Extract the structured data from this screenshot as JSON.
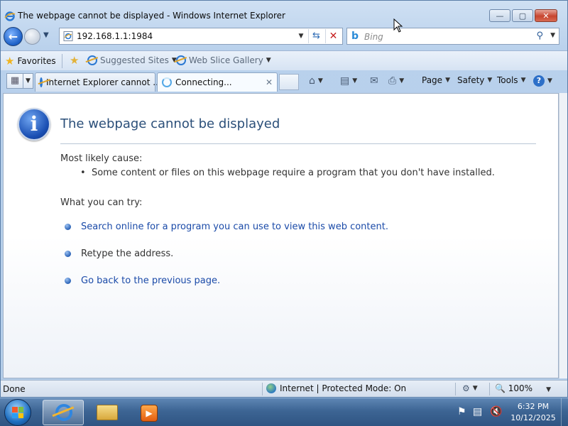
{
  "window": {
    "title": "The webpage cannot be displayed - Windows Internet Explorer",
    "caption_minimize": "—",
    "caption_maximize": "▢",
    "caption_close": "✕"
  },
  "navbar": {
    "address": "192.168.1.1:1984",
    "search_placeholder": "Bing",
    "search_engine_icon": "b"
  },
  "favorites_bar": {
    "favorites_label": "Favorites",
    "links": [
      {
        "label": "Suggested Sites"
      },
      {
        "label": "Web Slice Gallery"
      }
    ]
  },
  "tabs": [
    {
      "label": "Internet Explorer cannot ...",
      "state": "inactive"
    },
    {
      "label": "Connecting...",
      "state": "active"
    }
  ],
  "command_bar": {
    "page": "Page",
    "safety": "Safety",
    "tools": "Tools",
    "help": "?"
  },
  "error_page": {
    "title": "The webpage cannot be displayed",
    "cause_heading": "Most likely cause:",
    "cause_item": "Some content or files on this webpage require a program that you don't have installed.",
    "try_heading": "What you can try:",
    "actions": [
      {
        "text": "Search online for a program you can use to view this web content.",
        "type": "link"
      },
      {
        "text": "Retype the address.",
        "type": "text"
      },
      {
        "text": "Go back to the previous page.",
        "type": "link"
      }
    ]
  },
  "statusbar": {
    "status": "Done",
    "zone": "Internet | Protected Mode: On",
    "zoom": "100%"
  },
  "taskbar": {
    "time": "6:32 PM",
    "date": "10/12/2025"
  },
  "colors": {
    "link": "#1a4aa8",
    "title": "#2b4f79",
    "taskbar": "#3d6594"
  }
}
